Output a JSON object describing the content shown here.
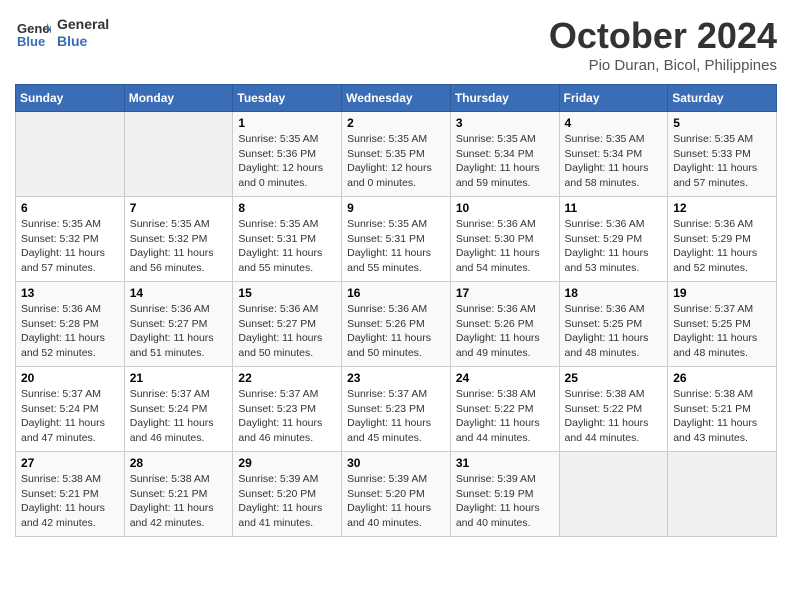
{
  "header": {
    "logo_line1": "General",
    "logo_line2": "Blue",
    "month": "October 2024",
    "location": "Pio Duran, Bicol, Philippines"
  },
  "weekdays": [
    "Sunday",
    "Monday",
    "Tuesday",
    "Wednesday",
    "Thursday",
    "Friday",
    "Saturday"
  ],
  "weeks": [
    [
      {
        "day": "",
        "info": ""
      },
      {
        "day": "",
        "info": ""
      },
      {
        "day": "1",
        "info": "Sunrise: 5:35 AM\nSunset: 5:36 PM\nDaylight: 12 hours\nand 0 minutes."
      },
      {
        "day": "2",
        "info": "Sunrise: 5:35 AM\nSunset: 5:35 PM\nDaylight: 12 hours\nand 0 minutes."
      },
      {
        "day": "3",
        "info": "Sunrise: 5:35 AM\nSunset: 5:34 PM\nDaylight: 11 hours\nand 59 minutes."
      },
      {
        "day": "4",
        "info": "Sunrise: 5:35 AM\nSunset: 5:34 PM\nDaylight: 11 hours\nand 58 minutes."
      },
      {
        "day": "5",
        "info": "Sunrise: 5:35 AM\nSunset: 5:33 PM\nDaylight: 11 hours\nand 57 minutes."
      }
    ],
    [
      {
        "day": "6",
        "info": "Sunrise: 5:35 AM\nSunset: 5:32 PM\nDaylight: 11 hours\nand 57 minutes."
      },
      {
        "day": "7",
        "info": "Sunrise: 5:35 AM\nSunset: 5:32 PM\nDaylight: 11 hours\nand 56 minutes."
      },
      {
        "day": "8",
        "info": "Sunrise: 5:35 AM\nSunset: 5:31 PM\nDaylight: 11 hours\nand 55 minutes."
      },
      {
        "day": "9",
        "info": "Sunrise: 5:35 AM\nSunset: 5:31 PM\nDaylight: 11 hours\nand 55 minutes."
      },
      {
        "day": "10",
        "info": "Sunrise: 5:36 AM\nSunset: 5:30 PM\nDaylight: 11 hours\nand 54 minutes."
      },
      {
        "day": "11",
        "info": "Sunrise: 5:36 AM\nSunset: 5:29 PM\nDaylight: 11 hours\nand 53 minutes."
      },
      {
        "day": "12",
        "info": "Sunrise: 5:36 AM\nSunset: 5:29 PM\nDaylight: 11 hours\nand 52 minutes."
      }
    ],
    [
      {
        "day": "13",
        "info": "Sunrise: 5:36 AM\nSunset: 5:28 PM\nDaylight: 11 hours\nand 52 minutes."
      },
      {
        "day": "14",
        "info": "Sunrise: 5:36 AM\nSunset: 5:27 PM\nDaylight: 11 hours\nand 51 minutes."
      },
      {
        "day": "15",
        "info": "Sunrise: 5:36 AM\nSunset: 5:27 PM\nDaylight: 11 hours\nand 50 minutes."
      },
      {
        "day": "16",
        "info": "Sunrise: 5:36 AM\nSunset: 5:26 PM\nDaylight: 11 hours\nand 50 minutes."
      },
      {
        "day": "17",
        "info": "Sunrise: 5:36 AM\nSunset: 5:26 PM\nDaylight: 11 hours\nand 49 minutes."
      },
      {
        "day": "18",
        "info": "Sunrise: 5:36 AM\nSunset: 5:25 PM\nDaylight: 11 hours\nand 48 minutes."
      },
      {
        "day": "19",
        "info": "Sunrise: 5:37 AM\nSunset: 5:25 PM\nDaylight: 11 hours\nand 48 minutes."
      }
    ],
    [
      {
        "day": "20",
        "info": "Sunrise: 5:37 AM\nSunset: 5:24 PM\nDaylight: 11 hours\nand 47 minutes."
      },
      {
        "day": "21",
        "info": "Sunrise: 5:37 AM\nSunset: 5:24 PM\nDaylight: 11 hours\nand 46 minutes."
      },
      {
        "day": "22",
        "info": "Sunrise: 5:37 AM\nSunset: 5:23 PM\nDaylight: 11 hours\nand 46 minutes."
      },
      {
        "day": "23",
        "info": "Sunrise: 5:37 AM\nSunset: 5:23 PM\nDaylight: 11 hours\nand 45 minutes."
      },
      {
        "day": "24",
        "info": "Sunrise: 5:38 AM\nSunset: 5:22 PM\nDaylight: 11 hours\nand 44 minutes."
      },
      {
        "day": "25",
        "info": "Sunrise: 5:38 AM\nSunset: 5:22 PM\nDaylight: 11 hours\nand 44 minutes."
      },
      {
        "day": "26",
        "info": "Sunrise: 5:38 AM\nSunset: 5:21 PM\nDaylight: 11 hours\nand 43 minutes."
      }
    ],
    [
      {
        "day": "27",
        "info": "Sunrise: 5:38 AM\nSunset: 5:21 PM\nDaylight: 11 hours\nand 42 minutes."
      },
      {
        "day": "28",
        "info": "Sunrise: 5:38 AM\nSunset: 5:21 PM\nDaylight: 11 hours\nand 42 minutes."
      },
      {
        "day": "29",
        "info": "Sunrise: 5:39 AM\nSunset: 5:20 PM\nDaylight: 11 hours\nand 41 minutes."
      },
      {
        "day": "30",
        "info": "Sunrise: 5:39 AM\nSunset: 5:20 PM\nDaylight: 11 hours\nand 40 minutes."
      },
      {
        "day": "31",
        "info": "Sunrise: 5:39 AM\nSunset: 5:19 PM\nDaylight: 11 hours\nand 40 minutes."
      },
      {
        "day": "",
        "info": ""
      },
      {
        "day": "",
        "info": ""
      }
    ]
  ]
}
